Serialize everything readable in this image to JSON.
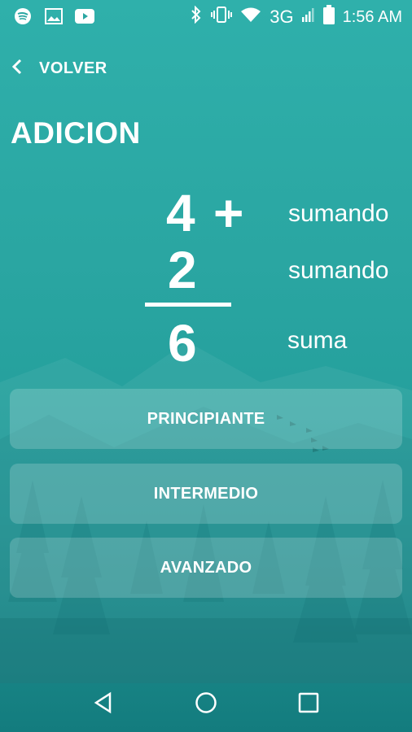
{
  "status_bar": {
    "icons_left": [
      "spotify-icon",
      "image-icon",
      "youtube-icon"
    ],
    "icons_right": [
      "bluetooth-icon",
      "vibrate-icon",
      "wifi-icon"
    ],
    "network": "3G",
    "time": "1:56 AM"
  },
  "header": {
    "back_label": "VOLVER",
    "title": "ADICION"
  },
  "equation": {
    "addend1": "4",
    "operator": "+",
    "addend2": "2",
    "result": "6",
    "addend1_term": "sumando",
    "addend2_term": "sumando",
    "result_term": "suma"
  },
  "levels": [
    {
      "label": "PRINCIPIANTE"
    },
    {
      "label": "INTERMEDIO"
    },
    {
      "label": "AVANZADO"
    }
  ],
  "colors": {
    "background_top": "#2fb0ab",
    "background_bottom": "#137c7e",
    "text": "#ffffff"
  }
}
